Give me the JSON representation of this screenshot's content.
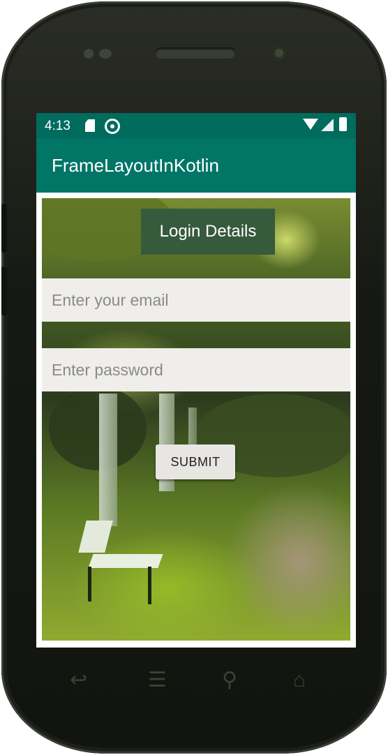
{
  "status_bar": {
    "time": "4:13",
    "icons": [
      "sd-card-icon",
      "sync-icon",
      "wifi-icon",
      "signal-icon",
      "battery-icon"
    ]
  },
  "app_bar": {
    "title": "FrameLayoutInKotlin"
  },
  "form": {
    "title": "Login Details",
    "email_placeholder": "Enter your email",
    "password_placeholder": "Enter password",
    "submit_label": "SUBMIT"
  },
  "nav_bar": {
    "back_glyph": "↩",
    "menu_glyph": "☰",
    "search_glyph": "⚲",
    "home_glyph": "⌂"
  },
  "colors": {
    "status_bar": "#016b5e",
    "app_bar": "#017566",
    "title_box": "#365a3c",
    "field_bg": "#efeeea",
    "button_bg": "#e7e6e2"
  }
}
